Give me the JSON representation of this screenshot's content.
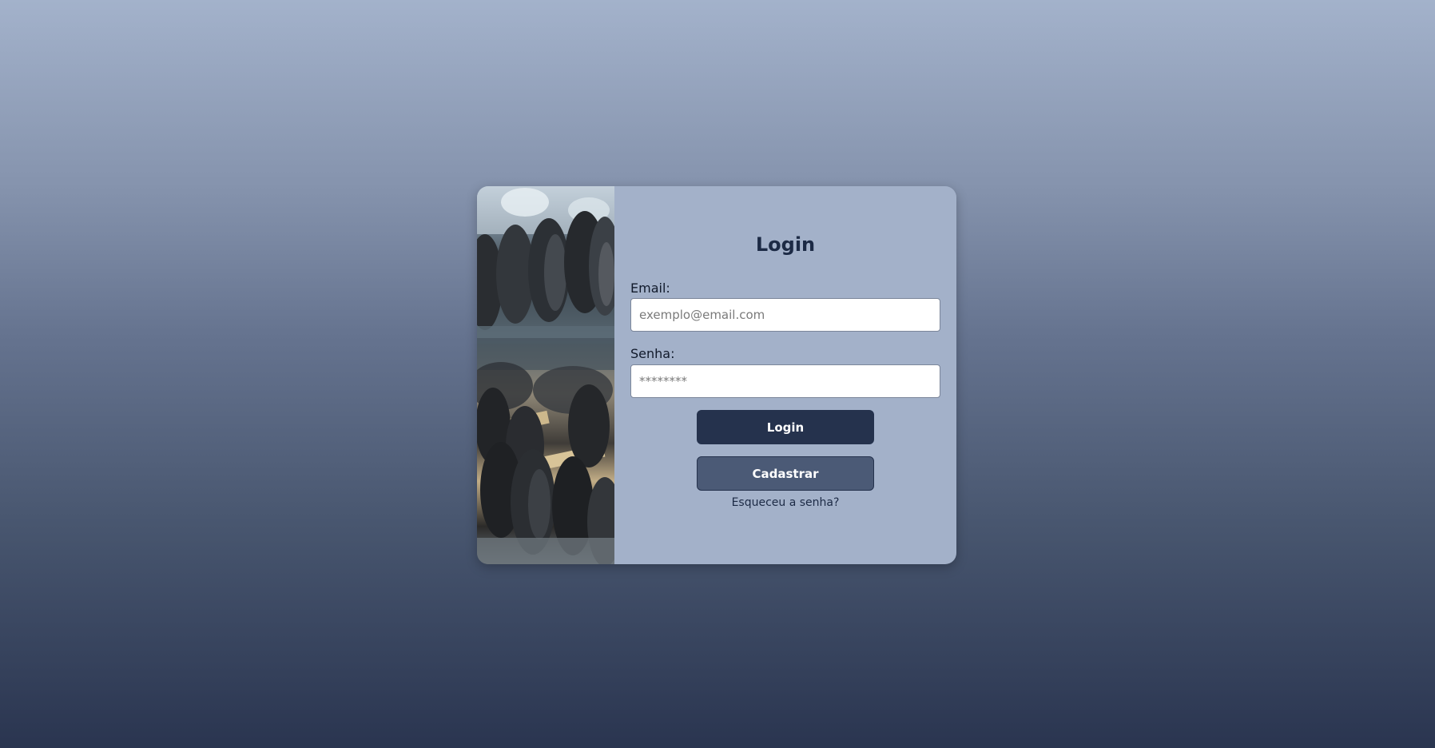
{
  "login_card": {
    "photo_alt": "Dumbbells on a rack",
    "title": "Login",
    "email": {
      "label": "Email:",
      "placeholder": "exemplo@email.com",
      "value": ""
    },
    "password": {
      "label": "Senha:",
      "placeholder": "********",
      "value": ""
    },
    "login_button": "Login",
    "register_button": "Cadastrar",
    "forgot_link": "Esqueceu a senha?"
  },
  "colors": {
    "panel_bg": "#a3b1c9",
    "title": "#1c2a45",
    "login_button": "#25324d",
    "register_button": "#4b5a76"
  }
}
